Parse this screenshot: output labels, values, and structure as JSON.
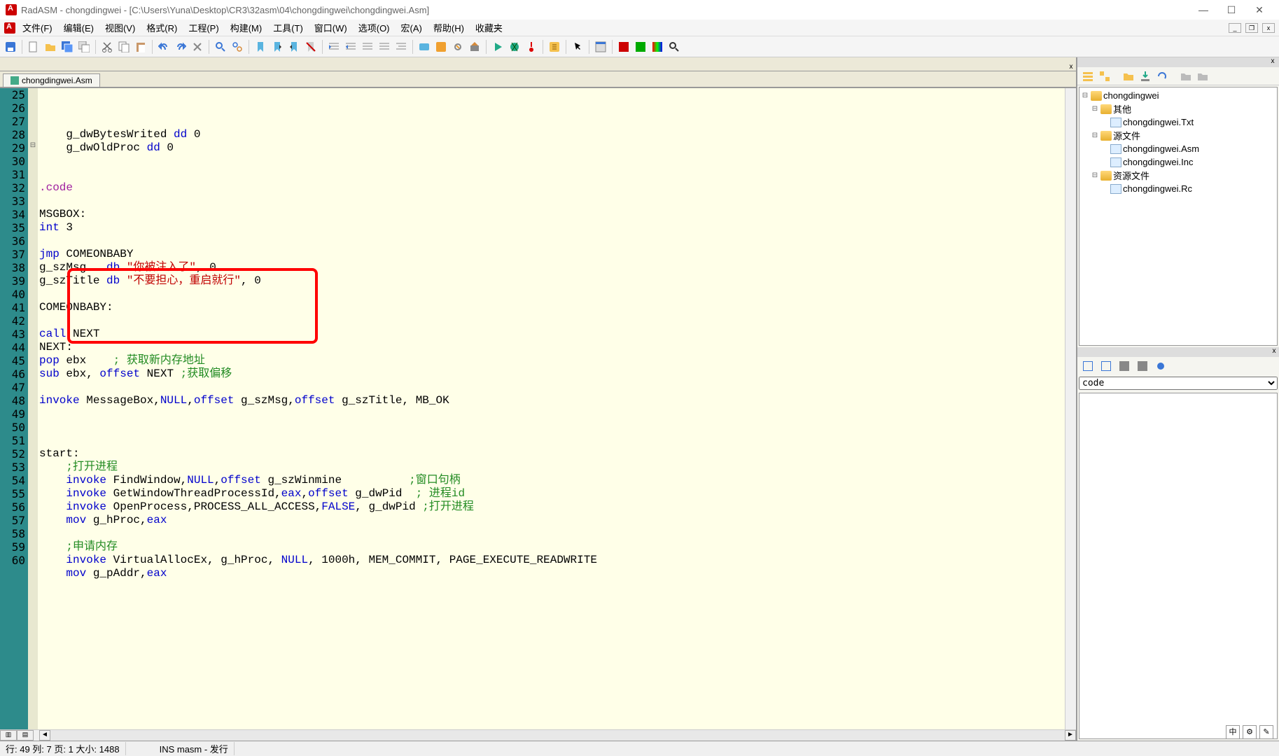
{
  "title": "RadASM - chongdingwei - [C:\\Users\\Yuna\\Desktop\\CR3\\32asm\\04\\chongdingwei\\chongdingwei.Asm]",
  "menu": {
    "file": "文件(F)",
    "edit": "编辑(E)",
    "view": "视图(V)",
    "format": "格式(R)",
    "project": "工程(P)",
    "build": "构建(M)",
    "tools": "工具(T)",
    "window": "窗口(W)",
    "options": "选项(O)",
    "macro": "宏(A)",
    "help": "帮助(H)",
    "fav": "收藏夹"
  },
  "tab": {
    "name": "chongdingwei.Asm"
  },
  "lines": [
    {
      "n": 25,
      "html": "    g_dwBytesWrited <span class='kw'>dd</span> 0"
    },
    {
      "n": 26,
      "html": "    g_dwOldProc <span class='kw'>dd</span> 0"
    },
    {
      "n": 27,
      "html": ""
    },
    {
      "n": 28,
      "html": ""
    },
    {
      "n": 29,
      "html": "<span class='dir'>.code</span>",
      "fold": "⊟"
    },
    {
      "n": 30,
      "html": ""
    },
    {
      "n": 31,
      "html": "MSGBOX:"
    },
    {
      "n": 32,
      "html": "<span class='kw'>int</span> 3"
    },
    {
      "n": 33,
      "html": ""
    },
    {
      "n": 34,
      "html": "<span class='kw'>jmp</span> COMEONBABY"
    },
    {
      "n": 35,
      "html": "g_szMsg   <span class='kw'>db</span> <span class='str'>\"你被注入了\"</span>, 0"
    },
    {
      "n": 36,
      "html": "g_szTitle <span class='kw'>db</span> <span class='str'>\"不要担心，重启就行\"</span>, 0"
    },
    {
      "n": 37,
      "html": ""
    },
    {
      "n": 38,
      "html": "COMEONBABY:"
    },
    {
      "n": 39,
      "html": ""
    },
    {
      "n": 40,
      "html": "<span class='kw'>call</span> NEXT"
    },
    {
      "n": 41,
      "html": "NEXT:"
    },
    {
      "n": 42,
      "html": "<span class='kw'>pop</span> ebx    <span class='cm'>; 获取新内存地址</span>"
    },
    {
      "n": 43,
      "html": "<span class='kw'>sub</span> ebx, <span class='kw'>offset</span> NEXT <span class='cm'>;获取偏移</span>"
    },
    {
      "n": 44,
      "html": ""
    },
    {
      "n": 45,
      "html": "<span class='kw'>invoke</span> MessageBox,<span class='kw'>NULL</span>,<span class='kw'>offset</span> g_szMsg,<span class='kw'>offset</span> g_szTitle, MB_OK"
    },
    {
      "n": 46,
      "html": ""
    },
    {
      "n": 47,
      "html": ""
    },
    {
      "n": 48,
      "html": ""
    },
    {
      "n": 49,
      "html": "start:"
    },
    {
      "n": 50,
      "html": "    <span class='cm'>;打开进程</span>"
    },
    {
      "n": 51,
      "html": "    <span class='kw'>invoke</span> FindWindow,<span class='kw'>NULL</span>,<span class='kw'>offset</span> g_szWinmine          <span class='cm'>;窗口句柄</span>"
    },
    {
      "n": 52,
      "html": "    <span class='kw'>invoke</span> GetWindowThreadProcessId,<span class='kw'>eax</span>,<span class='kw'>offset</span> g_dwPid  <span class='cm'>; 进程id</span>"
    },
    {
      "n": 53,
      "html": "    <span class='kw'>invoke</span> OpenProcess,PROCESS_ALL_ACCESS,<span class='kw'>FALSE</span>, g_dwPid <span class='cm'>;打开进程</span>"
    },
    {
      "n": 54,
      "html": "    <span class='kw'>mov</span> g_hProc,<span class='kw'>eax</span>"
    },
    {
      "n": 55,
      "html": ""
    },
    {
      "n": 56,
      "html": "    <span class='cm'>;申请内存</span>"
    },
    {
      "n": 57,
      "html": "    <span class='kw'>invoke</span> VirtualAllocEx, g_hProc, <span class='kw'>NULL</span>, 1000h, MEM_COMMIT, PAGE_EXECUTE_READWRITE"
    },
    {
      "n": 58,
      "html": "    <span class='kw'>mov</span> g_pAddr,<span class='kw'>eax</span>"
    },
    {
      "n": 59,
      "html": ""
    },
    {
      "n": 60,
      "html": ""
    }
  ],
  "tree": {
    "root": "chongdingwei",
    "n1": "其他",
    "f1": "chongdingwei.Txt",
    "n2": "源文件",
    "f2": "chongdingwei.Asm",
    "f3": "chongdingwei.Inc",
    "n3": "资源文件",
    "f4": "chongdingwei.Rc"
  },
  "prop": {
    "sel": "code"
  },
  "status": {
    "pos": "行: 49  列: 7 页: 1 大小: 1488",
    "mode": "INS masm - 发行"
  },
  "ime": {
    "a": "中",
    "b": "⚙",
    "c": "✎"
  }
}
